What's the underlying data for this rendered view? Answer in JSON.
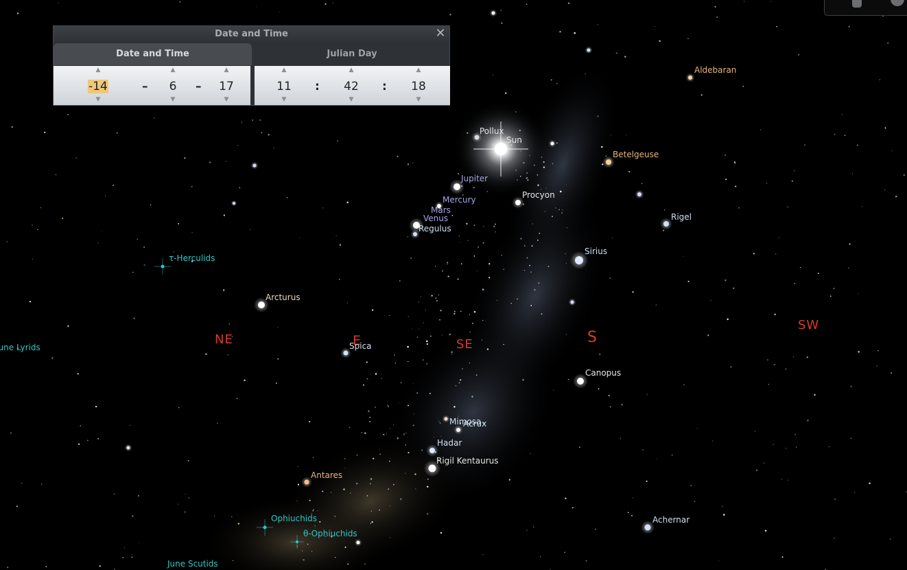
{
  "dialog": {
    "title": "Date and Time",
    "close": "✕",
    "tabs": [
      "Date and Time",
      "Julian Day"
    ],
    "date": {
      "year": "-14",
      "month": "6",
      "day": "17",
      "separator": "–"
    },
    "time": {
      "hour": "11",
      "minute": "42",
      "second": "18",
      "separator": ":"
    },
    "arrow_up": "▲",
    "arrow_down": "▼"
  },
  "colors": {
    "sky": "#000000",
    "cardinal": "#d63b2a",
    "star_label": "#cfe0ee",
    "warm_label": "#e8b57a",
    "planet_label": "#a6a6e6",
    "meteor_label": "#2ec7c7"
  },
  "cardinals": [
    "NE",
    "E",
    "SE",
    "S",
    "SW"
  ],
  "stars": [
    "Aldebaran",
    "Pollux",
    "Sun",
    "Betelgeuse",
    "Procyon",
    "Rigel",
    "Sirius",
    "Regulus",
    "Arcturus",
    "Spica",
    "Canopus",
    "Mimosa",
    "Acrux",
    "Hadar",
    "Rigil Kentaurus",
    "Antares",
    "Achernar"
  ],
  "planets": [
    "Jupiter",
    "Mercury",
    "Mars",
    "Venus"
  ],
  "meteor_showers": [
    "τ-Herculids",
    "June Lyrids",
    "Ophiuchids",
    "θ-Ophiuchids",
    "June Scutids"
  ]
}
